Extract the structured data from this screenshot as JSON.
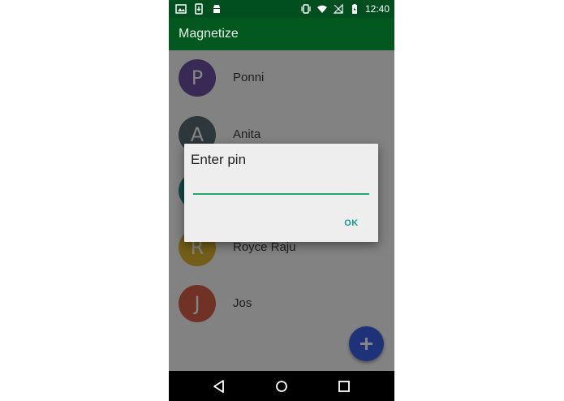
{
  "status_bar": {
    "time": "12:40",
    "left_icons": [
      "image-icon",
      "phone-download-icon",
      "android-icon"
    ],
    "right_icons": [
      "vibrate-icon",
      "wifi-icon",
      "no-signal-icon",
      "battery-charging-icon"
    ]
  },
  "app_bar": {
    "title": "Magnetize",
    "color": "#02581f"
  },
  "contacts": [
    {
      "initial": "P",
      "name": "Ponni",
      "color": "#6b4fa3"
    },
    {
      "initial": "A",
      "name": "Anita",
      "color": "#596a74"
    },
    {
      "initial": "",
      "name": "",
      "color": "#1f8f86"
    },
    {
      "initial": "R",
      "name": "Royce Raju",
      "color": "#dcb530"
    },
    {
      "initial": "J",
      "name": "Jos",
      "color": "#d66148"
    }
  ],
  "fab": {
    "icon": "plus-icon",
    "color": "#3b61e8"
  },
  "dialog": {
    "title": "Enter pin",
    "pin_value": "",
    "ok_label": "OK"
  },
  "nav_bar": {
    "icons": [
      "back-icon",
      "home-icon",
      "recents-icon"
    ]
  }
}
